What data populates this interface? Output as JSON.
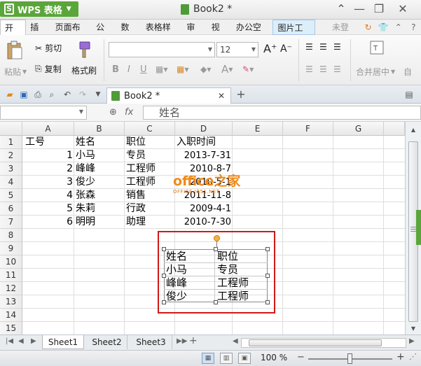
{
  "app": {
    "name": "WPS 表格",
    "logo_glyph": "S",
    "document_title": "Book2 *"
  },
  "menu": {
    "items": [
      "开始",
      "插入",
      "页面布局",
      "公式",
      "数据",
      "表格样式",
      "审阅",
      "视图",
      "办公空间",
      "图片工具"
    ],
    "active_index": 0,
    "tool_index": 9,
    "login_label": "未登录"
  },
  "ribbon": {
    "paste_label": "粘贴",
    "cut_label": "剪切",
    "copy_label": "复制",
    "format_painter_label": "格式刷",
    "font_name_value": "",
    "font_size_value": "12",
    "bold": "B",
    "italic": "I",
    "underline": "U",
    "merge_label": "合并居中",
    "auto_label": "自"
  },
  "tabs": {
    "doc_tab_label": "Book2 *"
  },
  "formula": {
    "name_box_value": "",
    "fx_label": "fx",
    "content": "姓名"
  },
  "grid": {
    "columns": [
      "A",
      "B",
      "C",
      "D",
      "E",
      "F",
      "G"
    ],
    "rows": [
      "1",
      "2",
      "3",
      "4",
      "5",
      "6",
      "7",
      "8",
      "9",
      "10",
      "11",
      "12",
      "13",
      "14",
      "15"
    ],
    "header_row": [
      "工号",
      "姓名",
      "职位",
      "入职时间"
    ],
    "records": [
      {
        "id": "1",
        "name": "小马",
        "title": "专员",
        "date": "2013-7-31"
      },
      {
        "id": "2",
        "name": "峰峰",
        "title": "工程师",
        "date": "2010-8-7"
      },
      {
        "id": "3",
        "name": "俊少",
        "title": "工程师",
        "date": "2010-5-1"
      },
      {
        "id": "4",
        "name": "张森",
        "title": "销售",
        "date": "2011-11-8"
      },
      {
        "id": "5",
        "name": "朱莉",
        "title": "行政",
        "date": "2009-4-1"
      },
      {
        "id": "6",
        "name": "明明",
        "title": "助理",
        "date": "2010-7-30"
      }
    ]
  },
  "picture": {
    "rows": [
      [
        "姓名",
        "职位"
      ],
      [
        "小马",
        "专员"
      ],
      [
        "峰峰",
        "工程师"
      ],
      [
        "俊少",
        "工程师"
      ]
    ]
  },
  "watermark": {
    "main": "office之家",
    "sub": "OFFICE.JB51.NET"
  },
  "sheets": {
    "tabs": [
      "Sheet1",
      "Sheet2",
      "Sheet3"
    ],
    "active_index": 0,
    "add_label": "+"
  },
  "status": {
    "zoom": "100 %"
  },
  "colors": {
    "app_green": "#5aa63a",
    "frame_red": "#d01818",
    "watermark_orange": "#f08a18"
  }
}
